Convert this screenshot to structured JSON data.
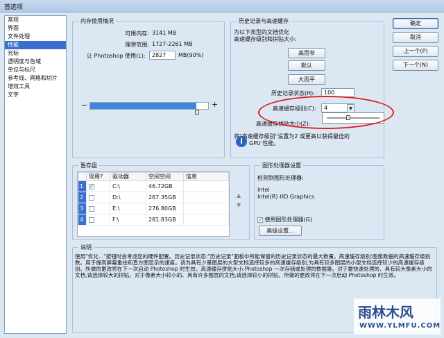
{
  "window": {
    "title": "首选项"
  },
  "sidebar": {
    "items": [
      "常规",
      "界面",
      "文件处理",
      "性能",
      "光标",
      "透明度与色域",
      "单位与标尺",
      "参考线、网格和切片",
      "增效工具",
      "文字"
    ],
    "selected_index": 3
  },
  "memory": {
    "title": "内存使用情况",
    "available_label": "可用内存:",
    "available_value": "3141 MB",
    "ideal_label": "理想范围:",
    "ideal_value": "1727-2261 MB",
    "use_label": "让 Photoshop 使用(L):",
    "use_value": "2827",
    "use_unit": "MB(90%)",
    "minus": "−",
    "plus": "+",
    "slider_percent": 90
  },
  "history": {
    "title": "历史记录与高速缓存",
    "hint_line1": "为以下类型的文档优化",
    "hint_line2": "高速缓存级别和拼贴大小:",
    "btn_tall_thin": "高而窄",
    "btn_default": "默认",
    "btn_big_flat": "大而平",
    "states_label": "历史记录状态(H):",
    "states_value": "100",
    "cache_levels_label": "高速缓存级别(C):",
    "cache_levels_value": "4",
    "tile_size_label": "高速缓存拼贴大小(Z):",
    "note_line1": "将\"高速缓存级别\"设置为2 或更高以获得最佳的",
    "note_line2": "GPU 性能。"
  },
  "scratch": {
    "title": "暂存盘",
    "headers": [
      "现用?",
      "驱动器",
      "空闲空间",
      "信息"
    ],
    "rows": [
      {
        "num": "1",
        "active": "✓",
        "drive": "C:\\",
        "free": "46.72GB"
      },
      {
        "num": "2",
        "active": "",
        "drive": "D:\\",
        "free": "267.35GB"
      },
      {
        "num": "3",
        "active": "",
        "drive": "E:\\",
        "free": "276.80GB"
      },
      {
        "num": "4",
        "active": "",
        "drive": "F:\\",
        "free": "281.83GB"
      }
    ],
    "up_arrow": "▲",
    "down_arrow": "▼"
  },
  "gpu": {
    "title": "图形处理器设置",
    "detected_label": "检测到图形处理器:",
    "vendor": "Intel",
    "model": "Intel(R) HD Graphics",
    "use_gpu_label": "使用图形处理器(G)",
    "use_gpu_checked": "✓",
    "advanced_button": "高级设置..."
  },
  "description": {
    "title": "说明",
    "text": "使用\"优化...\"按钮时会考虑您的硬件配置。历史记录状态:\"历史记录\"面板中所能保留的历史记录状态的最大数量。高速缓存级别:图像数据的高速缓存级别数。用于提高屏幕重绘和直方图显示的速度。请为具有少量图层的大型文档选择较多的高速缓存级别;为具有较多图层的小型文档选择较少的高速缓存级别。所做的更改将在下一次启动 Photoshop 时生效。高速缓存拼贴大小:Photoshop 一次存储或处理的数据量。对于要快速处理的、具有较大像素大小的文档,请选择较大的拼贴。对于像素大小较小的、具有许多图层的文档,请选择较小的拼贴。所做的更改将在下一次启动 Photoshop 时生效。"
  },
  "buttons": {
    "ok": "确定",
    "cancel": "取消",
    "prev": "上一个(P)",
    "next": "下一个(N)"
  },
  "watermark": {
    "brand": "雨林木风",
    "url": "WWW.YLMFU.COM"
  }
}
